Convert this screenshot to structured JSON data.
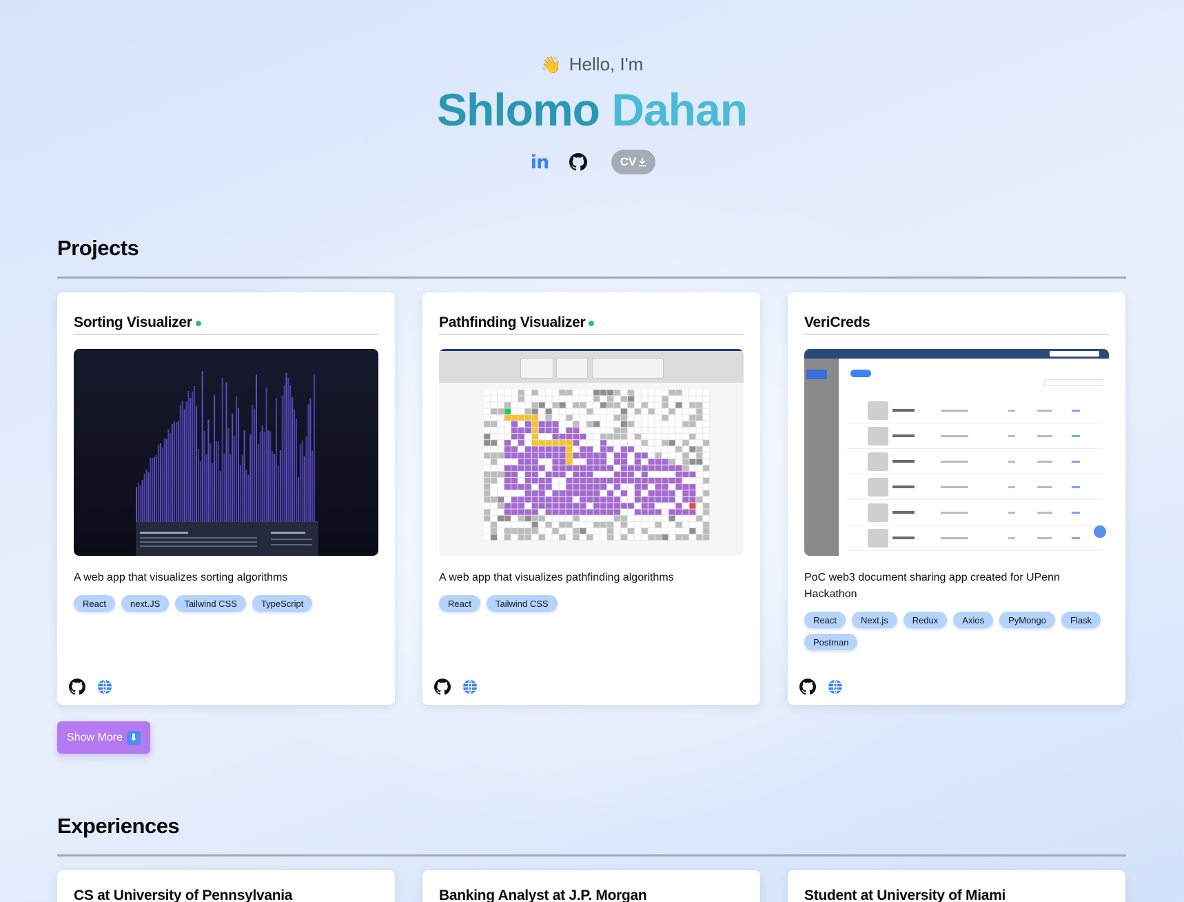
{
  "hero": {
    "wave_emoji": "👋",
    "greeting": "Hello, I'm",
    "first_name": "Shlomo",
    "last_name": "Dahan",
    "socials": {
      "linkedin_label": "in",
      "cv_label": "CV"
    }
  },
  "projects": {
    "heading": "Projects",
    "cards": [
      {
        "title": "Sorting Visualizer",
        "live": true,
        "description": "A web app that visualizes sorting algorithms",
        "tags": [
          "React",
          "next.JS",
          "Tailwind CSS",
          "TypeScript"
        ]
      },
      {
        "title": "Pathfinding Visualizer",
        "live": true,
        "description": "A web app that visualizes pathfinding algorithms",
        "tags": [
          "React",
          "Tailwind CSS"
        ]
      },
      {
        "title": "VeriCreds",
        "live": false,
        "description": "PoC web3 document sharing app created for UPenn Hackathon",
        "tags": [
          "React",
          "Next.js",
          "Redux",
          "Axios",
          "PyMongo",
          "Flask",
          "Postman"
        ]
      }
    ],
    "show_more_label": "Show More",
    "show_more_icon": "⬇"
  },
  "experiences": {
    "heading": "Experiences",
    "cards": [
      {
        "title": "CS at University of Pennsylvania"
      },
      {
        "title": "Banking Analyst at J.P. Morgan"
      },
      {
        "title": "Student at University of Miami"
      }
    ]
  },
  "colors": {
    "name_first": "#2a97b3",
    "name_last": "#4bbad6",
    "tag_bg": "#b6d3fb",
    "live_dot": "#22c55e",
    "show_more_bg": "#b57af2",
    "link_icon": "#3b82f6"
  },
  "icons": {
    "card_links": [
      "github-icon",
      "globe-icon"
    ]
  }
}
